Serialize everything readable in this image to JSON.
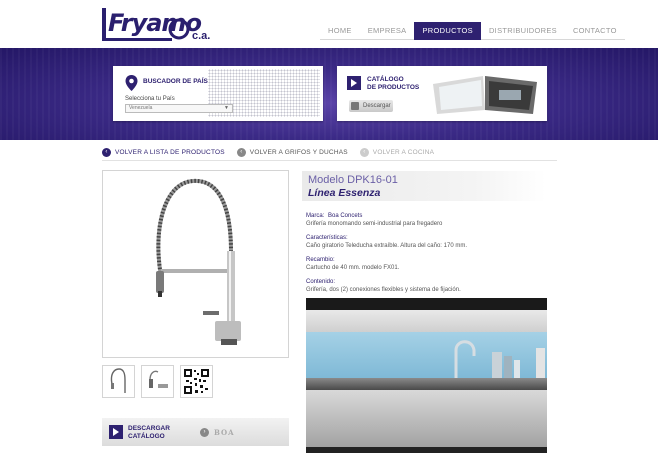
{
  "brand": {
    "logo_text": "Fryamo",
    "suffix": "c.a."
  },
  "nav": [
    "HOME",
    "EMPRESA",
    "PRODUCTOS",
    "DISTRIBUIDORES",
    "CONTACTO"
  ],
  "nav_active": "PRODUCTOS",
  "finder": {
    "title": "BUSCADOR DE PAÍS",
    "label": "Selecciona tu País",
    "selected": "Venezuela"
  },
  "catalog": {
    "title_line1": "CATÁLOGO",
    "title_line2": "DE PRODUCTOS",
    "download": "Descargar"
  },
  "crumbs": [
    "VOLVER A LISTA DE PRODUCTOS",
    "VOLVER A GRIFOS Y DUCHAS",
    "VOLVER A COCINA"
  ],
  "product": {
    "model": "Modelo DPK16-01",
    "line": "Línea Essenza",
    "specs": [
      {
        "key": "Marca:",
        "value": "Boa Concets"
      },
      {
        "key": "Grifería monomando semi-industrial para fregadero",
        "value": ""
      },
      {
        "key": "Características:",
        "value": "Caño giratorio Teleducha extraíble. Altura del caño: 170 mm."
      },
      {
        "key": "Recambio:",
        "value": "Cartucho de 40 mm. modelo FX01."
      },
      {
        "key": "Contenido:",
        "value": "Grifería, dos (2) conexiones flexibles y sistema de fijación."
      }
    ]
  },
  "download_catalog": {
    "line1": "DESCARGAR",
    "line2": "CATÁLOGO",
    "brand": "BOA"
  }
}
